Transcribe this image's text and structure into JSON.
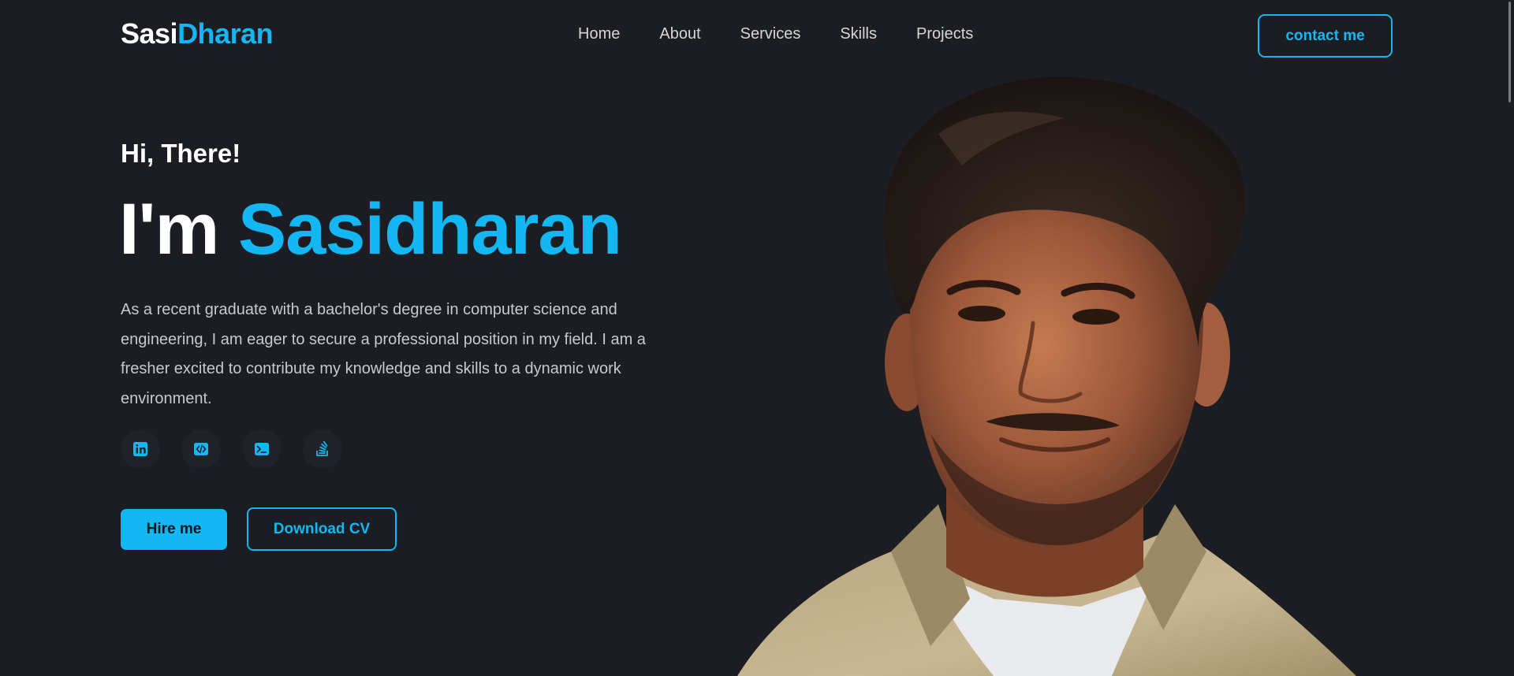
{
  "header": {
    "logo_part1": "Sasi",
    "logo_part2": "Dharan",
    "nav": [
      "Home",
      "About",
      "Services",
      "Skills",
      "Projects"
    ],
    "contact_label": "contact me"
  },
  "hero": {
    "greeting": "Hi, There!",
    "headline_prefix": "I'm",
    "headline_name": "Sasidharan",
    "bio": "As a recent graduate with a bachelor's degree in computer science and engineering, I am eager to secure a professional position in my field. I am a fresher excited to contribute my knowledge and skills to a dynamic work environment.",
    "socials": [
      {
        "icon": "linkedin-icon"
      },
      {
        "icon": "code-icon"
      },
      {
        "icon": "terminal-icon"
      },
      {
        "icon": "stack-overflow-icon"
      }
    ],
    "hire_label": "Hire me",
    "cv_label": "Download CV"
  },
  "colors": {
    "background": "#1b1d22",
    "accent": "#12b7f3",
    "text": "#ffffff",
    "muted_text": "#c7c9cf"
  }
}
